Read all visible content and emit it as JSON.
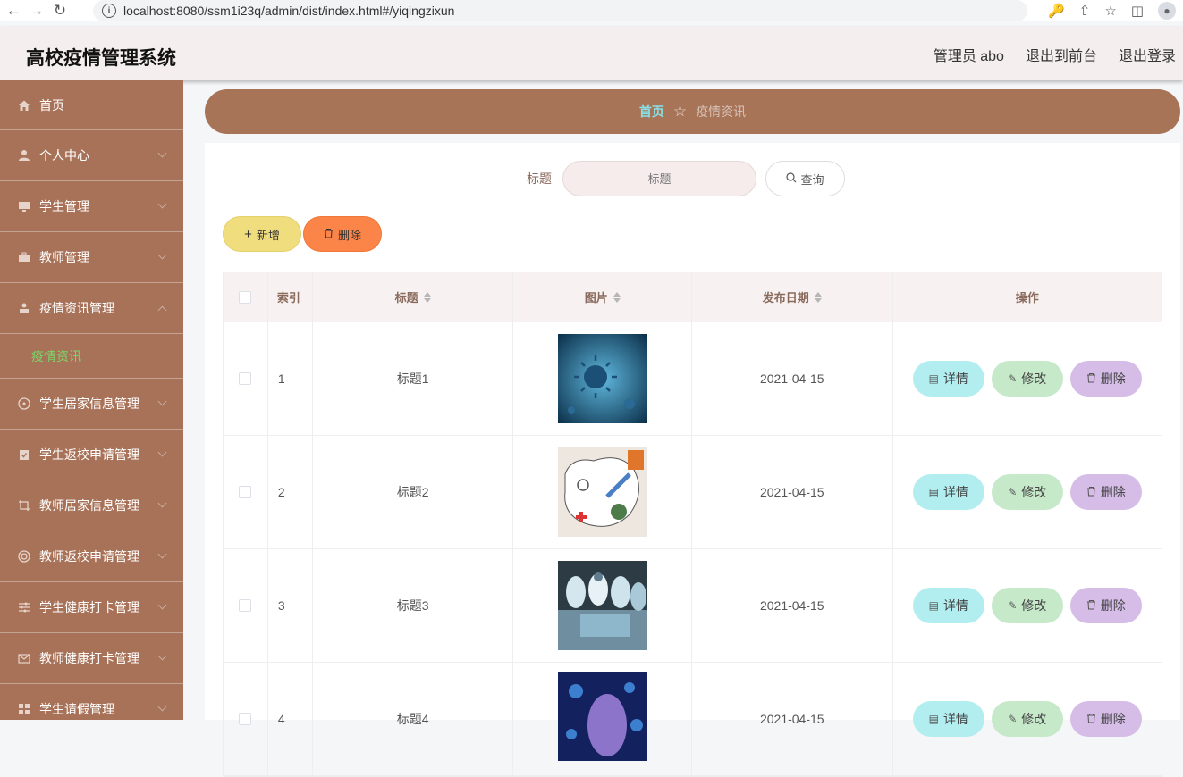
{
  "browser": {
    "url": "localhost:8080/ssm1i23q/admin/dist/index.html#/yiqingzixun"
  },
  "header": {
    "title": "高校疫情管理系统",
    "user": "管理员 abo",
    "to_front": "退出到前台",
    "logout": "退出登录"
  },
  "sidebar": {
    "items": [
      {
        "label": "首页",
        "icon": "home-icon"
      },
      {
        "label": "个人中心",
        "icon": "user-icon"
      },
      {
        "label": "学生管理",
        "icon": "monitor-icon"
      },
      {
        "label": "教师管理",
        "icon": "briefcase-icon"
      },
      {
        "label": "疫情资讯管理",
        "icon": "person-icon"
      },
      {
        "label": "学生居家信息管理",
        "icon": "compass-icon"
      },
      {
        "label": "学生返校申请管理",
        "icon": "clipboard-icon"
      },
      {
        "label": "教师居家信息管理",
        "icon": "crop-icon"
      },
      {
        "label": "教师返校申请管理",
        "icon": "lifebuoy-icon"
      },
      {
        "label": "学生健康打卡管理",
        "icon": "sliders-icon"
      },
      {
        "label": "教师健康打卡管理",
        "icon": "mail-icon"
      },
      {
        "label": "学生请假管理",
        "icon": "grid-icon"
      }
    ],
    "sub_item": "疫情资讯"
  },
  "breadcrumb": {
    "home": "首页",
    "current": "疫情资讯"
  },
  "search": {
    "label": "标题",
    "placeholder": "标题",
    "button": "查询"
  },
  "actions": {
    "add": "新增",
    "delete": "删除"
  },
  "table": {
    "headers": {
      "index": "索引",
      "title": "标题",
      "image": "图片",
      "date": "发布日期",
      "ops": "操作"
    },
    "rows": [
      {
        "index": "1",
        "title": "标题1",
        "date": "2021-04-15"
      },
      {
        "index": "2",
        "title": "标题2",
        "date": "2021-04-15"
      },
      {
        "index": "3",
        "title": "标题3",
        "date": "2021-04-15"
      },
      {
        "index": "4",
        "title": "标题4",
        "date": "2021-04-15"
      }
    ],
    "op_labels": {
      "detail": "详情",
      "edit": "修改",
      "delete": "删除"
    }
  },
  "colors": {
    "sidebar_bg": "#a87258",
    "header_bg": "#f5eeee",
    "active_sub": "#7bd66a",
    "breadcrumb_home": "#87e0e6"
  }
}
